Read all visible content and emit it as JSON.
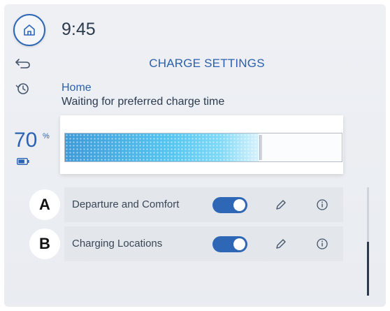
{
  "status_bar": {
    "time": "9:45"
  },
  "header": {
    "title": "CHARGE SETTINGS"
  },
  "location": {
    "name": "Home",
    "status": "Waiting for preferred charge time"
  },
  "battery": {
    "percent": "70",
    "percent_sign": "%",
    "fill_fraction": 0.7
  },
  "settings": [
    {
      "callout": "A",
      "label": "Departure and Comfort",
      "enabled": true
    },
    {
      "callout": "B",
      "label": "Charging Locations",
      "enabled": true
    }
  ],
  "colors": {
    "accent": "#2f67b7",
    "title": "#2a60ad",
    "charge_fill": "#56c6f0"
  },
  "icons": {
    "home": "home-icon",
    "back": "back-arrow-icon",
    "history": "history-icon",
    "battery": "battery-icon",
    "edit": "pencil-icon",
    "info": "info-icon"
  }
}
